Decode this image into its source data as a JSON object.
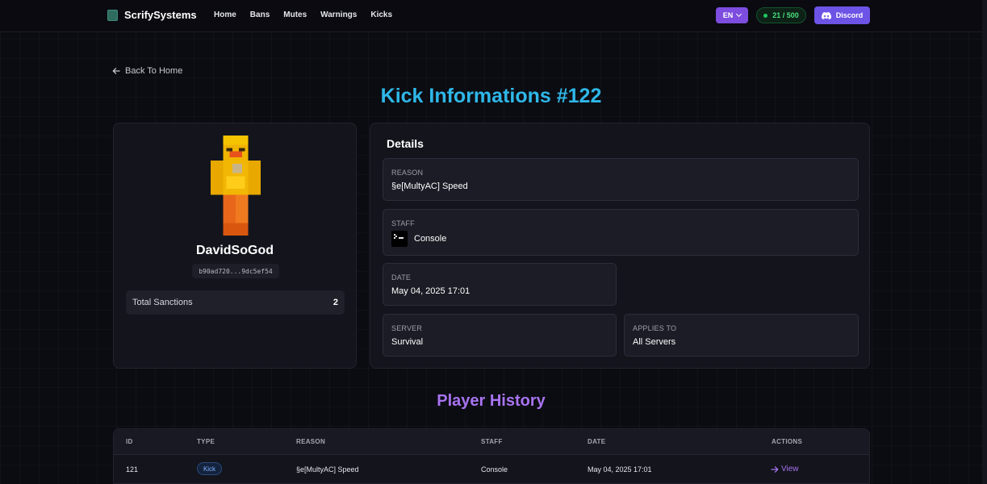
{
  "nav": {
    "brand": "ScrifySystems",
    "links": [
      "Home",
      "Bans",
      "Mutes",
      "Warnings",
      "Kicks"
    ],
    "language": "EN",
    "player_count": "21 / 500",
    "discord_label": "Discord",
    "colors": {
      "accent": "#7c4dde",
      "discord": "#6d53e6",
      "online": "#22c55e"
    }
  },
  "back_label": "Back To Home",
  "page_title": "Kick Informations #122",
  "profile": {
    "name": "DavidSoGod",
    "uuid": "b90ad720...9dc5ef54",
    "total_sanctions_label": "Total Sanctions",
    "total_sanctions_value": "2"
  },
  "details": {
    "title": "Details",
    "reason_label": "REASON",
    "reason_value": "§e[MultyAC] Speed",
    "staff_label": "STAFF",
    "staff_value": "Console",
    "date_label": "DATE",
    "date_value": "May 04, 2025 17:01",
    "server_label": "SERVER",
    "server_value": "Survival",
    "applies_label": "APPLIES TO",
    "applies_value": "All Servers"
  },
  "history": {
    "title": "Player History",
    "columns": [
      "ID",
      "TYPE",
      "REASON",
      "STAFF",
      "DATE",
      "ACTIONS"
    ],
    "rows": [
      {
        "id": "121",
        "type": "Kick",
        "reason": "§e[MultyAC] Speed",
        "staff": "Console",
        "date": "May 04, 2025 17:01",
        "action": "View"
      }
    ]
  }
}
